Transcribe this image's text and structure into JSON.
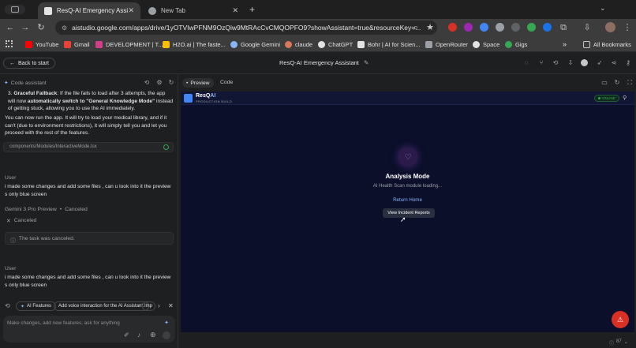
{
  "browser": {
    "tabs": [
      {
        "title": "ResQ-AI Emergency Assista",
        "active": true
      },
      {
        "title": "New Tab",
        "active": false
      }
    ],
    "url": "aistudio.google.com/apps/drive/1yOTVIwPFNM9OzQiw9MtRAcCvCMQOPFO9?showAssistant=true&resourceKey=...",
    "bookmarks": [
      "YouTube",
      "Gmail",
      "DEVELOPMENT | T...",
      "H2O.ai | The faste...",
      "Google Gemini",
      "claude",
      "ChatGPT",
      "Bohr | AI for Scien...",
      "OpenRouter",
      "Space",
      "Gigs"
    ],
    "all_bookmarks": "All Bookmarks",
    "overflow": "»"
  },
  "app": {
    "back_label": "Back to start",
    "title": "ResQ-AI Emergency Assistant"
  },
  "assistant": {
    "header": "Code assistant",
    "fallback_title": "Graceful Fallback",
    "fallback_text_1": ": If the file fails to load after 3 attempts, the app will now ",
    "fallback_bold": "automatically switch to \"General Knowledge Mode\"",
    "fallback_text_2": " instead of getting stuck, allowing you to use the AI immediately.",
    "paragraph": "You can now run the app. It will try to load your medical library, and if it can't (due to environment restrictions), it will simply tell you and let you proceed with the rest of the features.",
    "file_path": "components/Modules/InteractiveMode.tsx",
    "user_label_1": "User",
    "user_msg_1": "i made some changes and add some files , can u look into it the preview s only blue screen",
    "model_status": "Gemini 3 Pro Preview",
    "model_state": "Canceled",
    "canceled_label": "Canceled",
    "canceled_card": "The task was canceled.",
    "user_label_2": "User",
    "user_msg_2": "i made some changes and add some files , can u look into it the preview s only blue screen",
    "chips": [
      "AI Features",
      "Add voice interaction for the AI Assistant.",
      "Imp"
    ],
    "composer_placeholder": "Make changes, add new features, ask for anything"
  },
  "preview": {
    "tabs": [
      "Preview",
      "Code"
    ],
    "brand": "ResQ",
    "brand_ai": "AI",
    "brand_sub": "PRODUCTION BUILD",
    "online": "ONLINE",
    "mode_title": "Analysis Mode",
    "mode_sub": "AI Health Scan module loading...",
    "return_home": "Return Home",
    "view_reports": "View Incident Reports",
    "status_count": "87"
  },
  "colors": {
    "accent_blue": "#8ab4f8",
    "preview_bg": "#0b0f2a",
    "online_green": "#34a853",
    "sos_red": "#d93025"
  }
}
